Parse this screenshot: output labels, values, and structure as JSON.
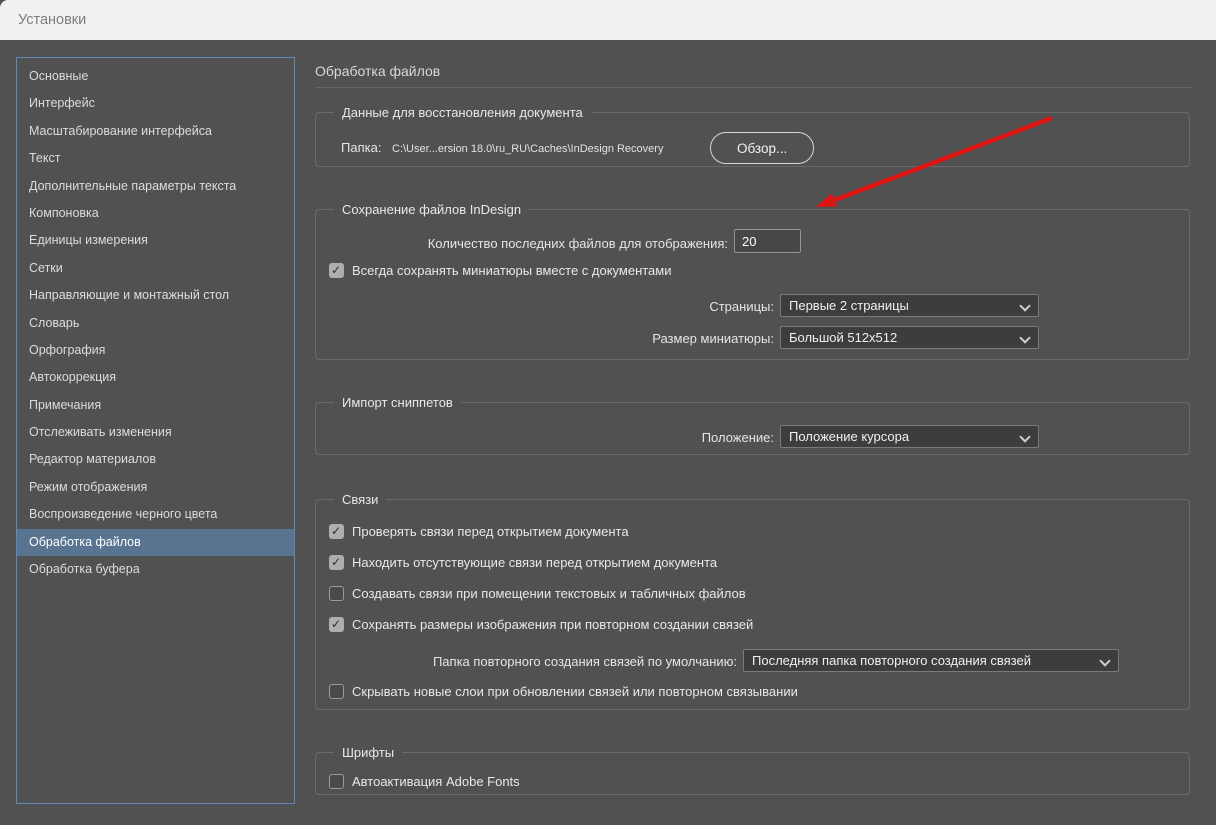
{
  "window": {
    "title": "Установки"
  },
  "sidebar": {
    "items": [
      {
        "label": "Основные",
        "selected": false
      },
      {
        "label": "Интерфейс",
        "selected": false
      },
      {
        "label": "Масштабирование интерфейса",
        "selected": false
      },
      {
        "label": "Текст",
        "selected": false
      },
      {
        "label": "Дополнительные параметры текста",
        "selected": false
      },
      {
        "label": "Компоновка",
        "selected": false
      },
      {
        "label": "Единицы измерения",
        "selected": false
      },
      {
        "label": "Сетки",
        "selected": false
      },
      {
        "label": "Направляющие и монтажный стол",
        "selected": false
      },
      {
        "label": "Словарь",
        "selected": false
      },
      {
        "label": "Орфография",
        "selected": false
      },
      {
        "label": "Автокоррекция",
        "selected": false
      },
      {
        "label": "Примечания",
        "selected": false
      },
      {
        "label": "Отслеживать изменения",
        "selected": false
      },
      {
        "label": "Редактор материалов",
        "selected": false
      },
      {
        "label": "Режим отображения",
        "selected": false
      },
      {
        "label": "Воспроизведение черного цвета",
        "selected": false
      },
      {
        "label": "Обработка файлов",
        "selected": true
      },
      {
        "label": "Обработка буфера",
        "selected": false
      }
    ]
  },
  "main": {
    "title": "Обработка файлов",
    "recovery": {
      "legend": "Данные для восстановления документа",
      "folder_label": "Папка:",
      "folder_path": "C:\\User...ersion 18.0\\ru_RU\\Caches\\InDesign Recovery",
      "browse_button": "Обзор..."
    },
    "saving": {
      "legend": "Сохранение файлов InDesign",
      "recent_files_label": "Количество последних файлов для отображения:",
      "recent_files_value": "20",
      "thumbnails_checkbox": {
        "label": "Всегда сохранять миниатюры вместе с документами",
        "checked": true
      },
      "pages_label": "Страницы:",
      "pages_value": "Первые 2 страницы",
      "thumb_size_label": "Размер миниатюры:",
      "thumb_size_value": "Большой 512x512"
    },
    "snippets": {
      "legend": "Импорт сниппетов",
      "position_label": "Положение:",
      "position_value": "Положение курсора"
    },
    "links": {
      "legend": "Связи",
      "checkboxes": [
        {
          "label": "Проверять связи перед открытием документа",
          "checked": true
        },
        {
          "label": "Находить отсутствующие связи перед открытием документа",
          "checked": true
        },
        {
          "label": "Создавать связи при помещении текстовых и табличных файлов",
          "checked": false
        },
        {
          "label": "Сохранять размеры изображения при повторном создании связей",
          "checked": true
        }
      ],
      "relink_folder_label": "Папка повторного создания связей по умолчанию:",
      "relink_folder_value": "Последняя папка повторного создания связей",
      "hide_layers_checkbox": {
        "label": "Скрывать новые слои при обновлении связей или повторном связывании",
        "checked": false
      }
    },
    "fonts": {
      "legend": "Шрифты",
      "autoactivate_checkbox": {
        "label": "Автоактивация Adobe Fonts",
        "checked": false
      }
    }
  },
  "colors": {
    "dialog_background": "#515151",
    "titlebar_background": "#f1f1f1",
    "sidebar_border": "#5f8ab8",
    "selected_item_background": "#587490",
    "annotation_arrow": "#dd1411"
  }
}
